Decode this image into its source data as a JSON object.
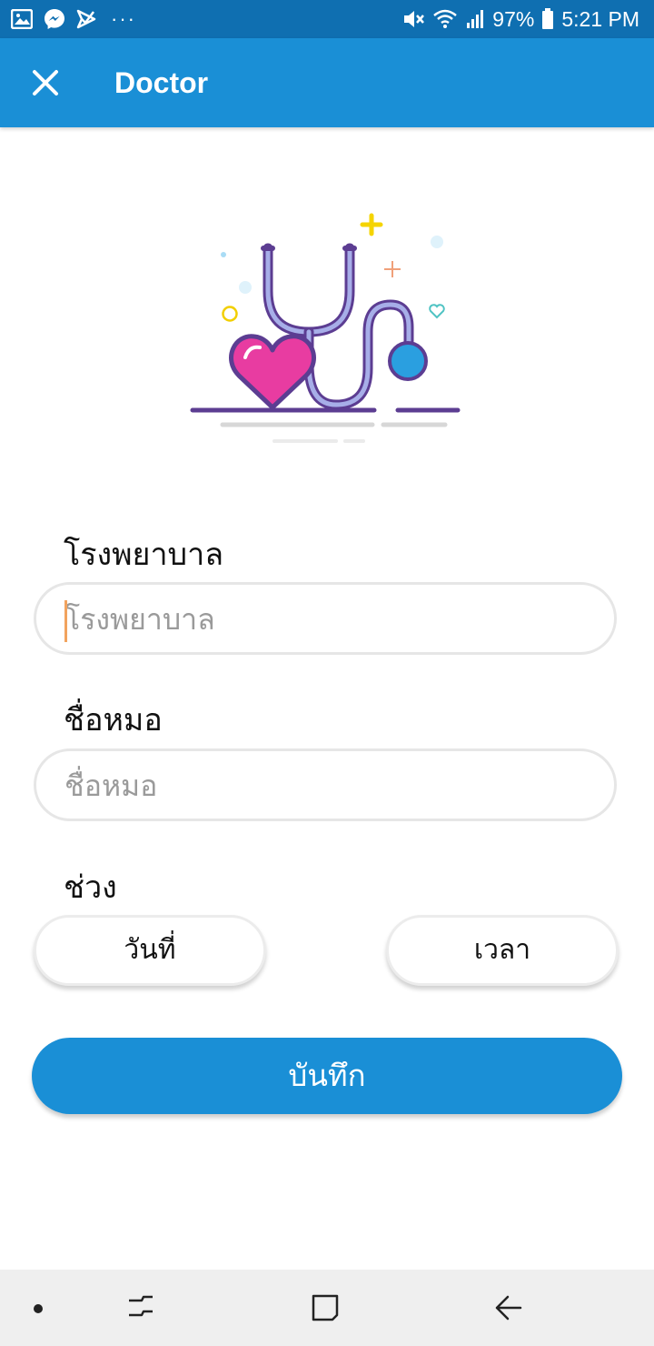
{
  "status_bar": {
    "battery": "97%",
    "time": "5:21 PM",
    "icons": [
      "gallery-icon",
      "messenger-icon",
      "check-icon",
      "more-dots-icon",
      "mute-icon",
      "wifi-icon",
      "signal-icon",
      "battery-icon"
    ],
    "more": "···"
  },
  "app_bar": {
    "title": "Doctor",
    "close_icon": "close-icon",
    "color": "#1a8fd6"
  },
  "form": {
    "hospital_label": "โรงพยาบาล",
    "hospital_placeholder": "โรงพยาบาล",
    "doctor_label": "ชื่อหมอ",
    "doctor_placeholder": "ชื่อหมอ",
    "period_label": "ช่วง",
    "date_button": "วันที่",
    "time_button": "เวลา",
    "save_button": "บันทึก"
  },
  "nav_bar": {
    "icons": [
      "dot-icon",
      "recents-icon",
      "home-icon",
      "back-icon"
    ]
  }
}
